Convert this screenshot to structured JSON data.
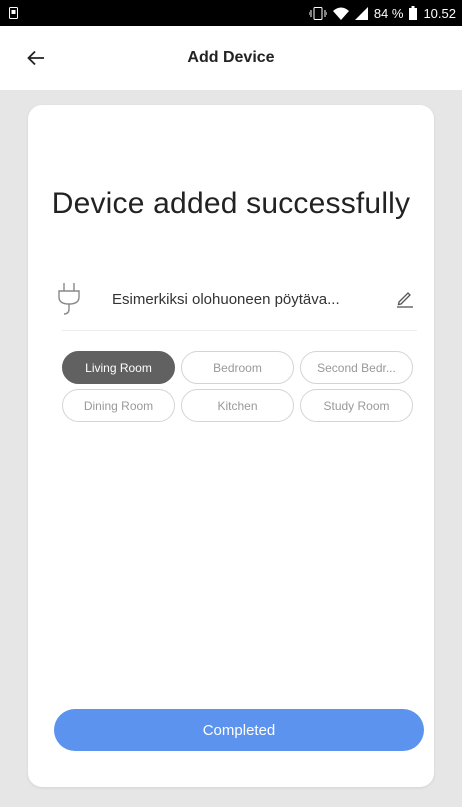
{
  "status_bar": {
    "battery_percent": "84 %",
    "time": "10.52",
    "icons": [
      "screenshot-icon",
      "vibrate-icon",
      "wifi-icon",
      "signal-icon",
      "battery-icon"
    ]
  },
  "header": {
    "title": "Add Device",
    "back_icon": "arrow-left-icon"
  },
  "main": {
    "headline": "Device added successfully",
    "device": {
      "name": "Esimerkiksi olohuoneen pöytävalaisin",
      "icon": "plug-icon",
      "edit_icon": "pencil-icon"
    },
    "rooms": [
      {
        "label": "Living Room",
        "selected": true
      },
      {
        "label": "Bedroom",
        "selected": false
      },
      {
        "label": "Second Bedroom",
        "selected": false
      },
      {
        "label": "Dining Room",
        "selected": false
      },
      {
        "label": "Kitchen",
        "selected": false
      },
      {
        "label": "Study Room",
        "selected": false
      }
    ],
    "complete_button": "Completed"
  },
  "colors": {
    "accent": "#5b93ee",
    "selected_chip": "#616161",
    "background": "#e6e6e6"
  }
}
